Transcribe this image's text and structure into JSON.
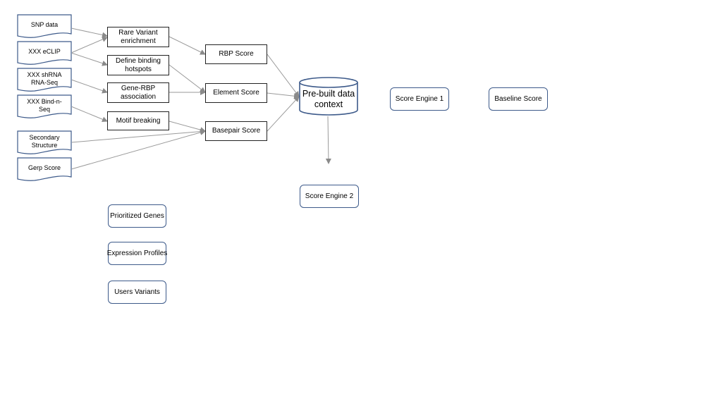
{
  "diagram": {
    "sources": [
      {
        "id": "snp",
        "label": "SNP data"
      },
      {
        "id": "eclip",
        "label": "XXX eCLIP"
      },
      {
        "id": "shrna",
        "label": "XXX shRNA RNA-Seq"
      },
      {
        "id": "bindnseq",
        "label": "XXX Bind-n-Seq"
      },
      {
        "id": "secondary",
        "label": "Secondary Structure"
      },
      {
        "id": "gerp",
        "label": "Gerp Score"
      }
    ],
    "processes": [
      {
        "id": "rare",
        "label": "Rare Variant enrichment"
      },
      {
        "id": "hotspots",
        "label": "Define binding hotspots"
      },
      {
        "id": "generbp",
        "label": "Gene-RBP association"
      },
      {
        "id": "motif",
        "label": "Motif breaking"
      }
    ],
    "scores": [
      {
        "id": "rbp",
        "label": "RBP Score"
      },
      {
        "id": "element",
        "label": "Element Score"
      },
      {
        "id": "basepair",
        "label": "Basepair Score"
      }
    ],
    "database": {
      "id": "prebuilt",
      "label": "Pre-built data context"
    },
    "outputs": [
      {
        "id": "engine1",
        "label": "Score Engine 1"
      },
      {
        "id": "baseline",
        "label": "Baseline Score"
      },
      {
        "id": "engine2",
        "label": "Score Engine 2"
      },
      {
        "id": "genes",
        "label": "Prioritized Genes"
      },
      {
        "id": "expression",
        "label": "Expression Profiles"
      },
      {
        "id": "variants",
        "label": "Users Variants"
      }
    ],
    "edges": [
      {
        "from": "snp",
        "to": "rare"
      },
      {
        "from": "eclip",
        "to": "rare"
      },
      {
        "from": "eclip",
        "to": "hotspots"
      },
      {
        "from": "shrna",
        "to": "generbp"
      },
      {
        "from": "bindnseq",
        "to": "motif"
      },
      {
        "from": "rare",
        "to": "rbp"
      },
      {
        "from": "hotspots",
        "to": "element"
      },
      {
        "from": "generbp",
        "to": "element"
      },
      {
        "from": "motif",
        "to": "basepair"
      },
      {
        "from": "secondary",
        "to": "basepair"
      },
      {
        "from": "gerp",
        "to": "basepair"
      },
      {
        "from": "rbp",
        "to": "prebuilt"
      },
      {
        "from": "element",
        "to": "prebuilt"
      },
      {
        "from": "basepair",
        "to": "prebuilt"
      },
      {
        "from": "prebuilt",
        "to": "engine2-arrow"
      }
    ]
  }
}
